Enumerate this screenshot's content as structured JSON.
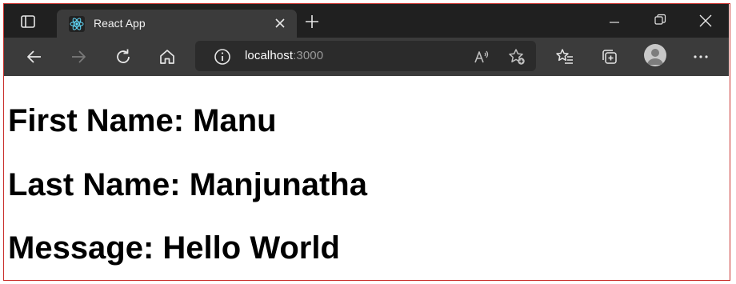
{
  "tab": {
    "title": "React App"
  },
  "address": {
    "host": "localhost",
    "port": ":3000"
  },
  "page": {
    "first_name": "First Name: Manu",
    "last_name": "Last Name: Manjunatha",
    "message": "Message: Hello World"
  },
  "icons": {
    "tab_actions": "tab-actions-icon",
    "favicon": "react-icon",
    "tab_close": "close-icon",
    "new_tab": "plus-icon",
    "minimize": "minimize-icon",
    "restore": "restore-icon",
    "close_window": "close-icon",
    "back": "back-arrow-icon",
    "forward": "forward-arrow-icon",
    "refresh": "refresh-icon",
    "home": "home-icon",
    "site_info": "info-icon",
    "read_aloud": "read-aloud-icon",
    "add_favorite": "star-plus-icon",
    "favorites": "favorites-icon",
    "collections": "collections-icon",
    "profile": "avatar-icon",
    "more": "more-icon"
  },
  "colors": {
    "titlebar": "#202020",
    "active_tab": "#3b3b3b",
    "toolbar": "#3b3b3b",
    "addressbar": "#2b2b2b",
    "react_blue": "#61dafb",
    "frame_border": "#c9302c"
  }
}
